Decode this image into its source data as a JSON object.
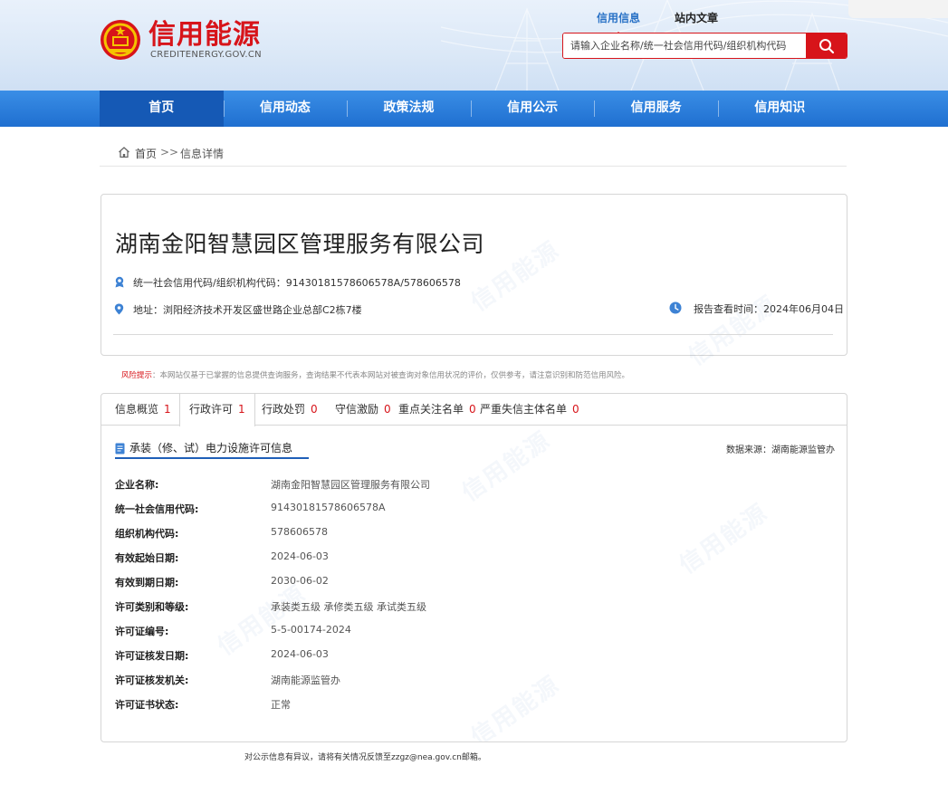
{
  "site": {
    "title": "信用能源",
    "subtitle": "CREDITENERGY.GOV.CN"
  },
  "search": {
    "tabs": [
      {
        "label": "信用信息",
        "active": true
      },
      {
        "label": "站内文章",
        "active": false
      }
    ],
    "placeholder": "请输入企业名称/统一社会信用代码/组织机构代码"
  },
  "nav": {
    "items": [
      {
        "label": "首页",
        "active": true
      },
      {
        "label": "信用动态",
        "active": false
      },
      {
        "label": "政策法规",
        "active": false
      },
      {
        "label": "信用公示",
        "active": false
      },
      {
        "label": "信用服务",
        "active": false
      },
      {
        "label": "信用知识",
        "active": false
      }
    ]
  },
  "breadcrumb": {
    "home": "首页",
    "separator": ">>",
    "current": "信息详情"
  },
  "company": {
    "name": "湖南金阳智慧园区管理服务有限公司",
    "credit_code_line": "统一社会信用代码/组织机构代码：91430181578606578A/578606578",
    "address_line": "地址：浏阳经济技术开发区盛世路企业总部C2栋7楼",
    "report_time_line": "报告查看时间：2024年06月04日"
  },
  "watermark_text": "信用能源",
  "risk": {
    "label": "风险提示",
    "text": "：本网站仅基于已掌握的信息提供查询服务，查询结果不代表本网站对被查询对象信用状况的评价，仅供参考，请注意识别和防范信用风险。"
  },
  "tabs": [
    {
      "label": "信息概览",
      "count": "1",
      "active": false
    },
    {
      "label": "行政许可",
      "count": "1",
      "active": true
    },
    {
      "label": "行政处罚",
      "count": "0",
      "active": false
    },
    {
      "label": "守信激励",
      "count": "0",
      "active": false
    },
    {
      "label": "重点关注名单",
      "count": "0",
      "active": false
    },
    {
      "label": "严重失信主体名单",
      "count": "0",
      "active": false
    }
  ],
  "section": {
    "title": "承装（修、试）电力设施许可信息",
    "data_source": "数据来源：湖南能源监管办"
  },
  "fields": [
    {
      "label": "企业名称:",
      "value": "湖南金阳智慧园区管理服务有限公司"
    },
    {
      "label": "统一社会信用代码:",
      "value": "91430181578606578A"
    },
    {
      "label": "组织机构代码:",
      "value": "578606578"
    },
    {
      "label": "有效起始日期:",
      "value": "2024-06-03"
    },
    {
      "label": "有效到期日期:",
      "value": "2030-06-02"
    },
    {
      "label": "许可类别和等级:",
      "value": "承装类五级 承修类五级 承试类五级"
    },
    {
      "label": "许可证编号:",
      "value": "5-5-00174-2024"
    },
    {
      "label": "许可证核发日期:",
      "value": "2024-06-03"
    },
    {
      "label": "许可证核发机关:",
      "value": "湖南能源监管办"
    },
    {
      "label": "许可证书状态:",
      "value": "正常"
    }
  ],
  "footer": {
    "note": "对公示信息有异议，请将有关情况反馈至zzgz@nea.gov.cn邮箱。"
  },
  "colors": {
    "brand_red": "#d7141a",
    "nav_blue": "#1f6fd0",
    "nav_active": "#1559b5",
    "accent_blue": "#2a72c6"
  }
}
